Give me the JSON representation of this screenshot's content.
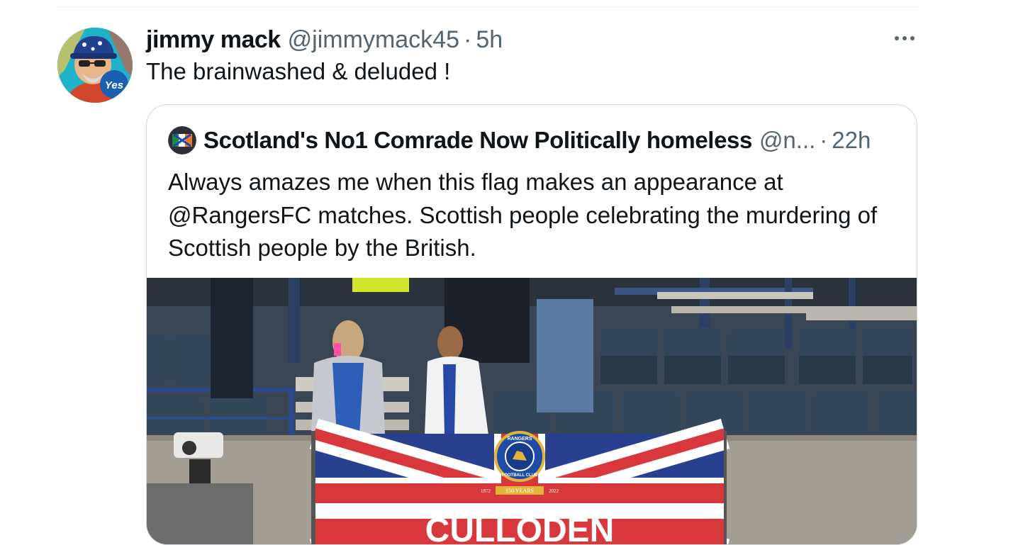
{
  "tweet": {
    "display_name": "jimmy mack",
    "handle": "@jimmymack45",
    "separator": "·",
    "timestamp": "5h",
    "text": "The brainwashed & deluded !",
    "avatar_badge": "Yes",
    "more_icon": "ellipsis-icon"
  },
  "quoted_tweet": {
    "display_name": "Scotland's No1 Comrade Now Politically homeless",
    "handle": "@n...",
    "separator": "·",
    "timestamp": "22h",
    "text_lines": [
      "Always amazes me when this flag makes an appearance at",
      "@RangersFC matches. Scottish people celebrating the murdering of",
      "Scottish people by the British."
    ],
    "media": {
      "description_icon": "photo-icon",
      "crest_top_text": "RANGERS",
      "crest_bottom_text": "FOOTBALL CLUB",
      "crest_ribbon": "150 YEARS",
      "crest_year_left": "1872",
      "crest_year_right": "2022",
      "banner_text": "CULLODEN"
    }
  },
  "colors": {
    "primary_text": "#0f1419",
    "secondary_text": "#536471",
    "border": "#cfd9de",
    "divider": "#eff3f4",
    "flag_blue": "#2b3f8f",
    "flag_red": "#d8383c"
  }
}
